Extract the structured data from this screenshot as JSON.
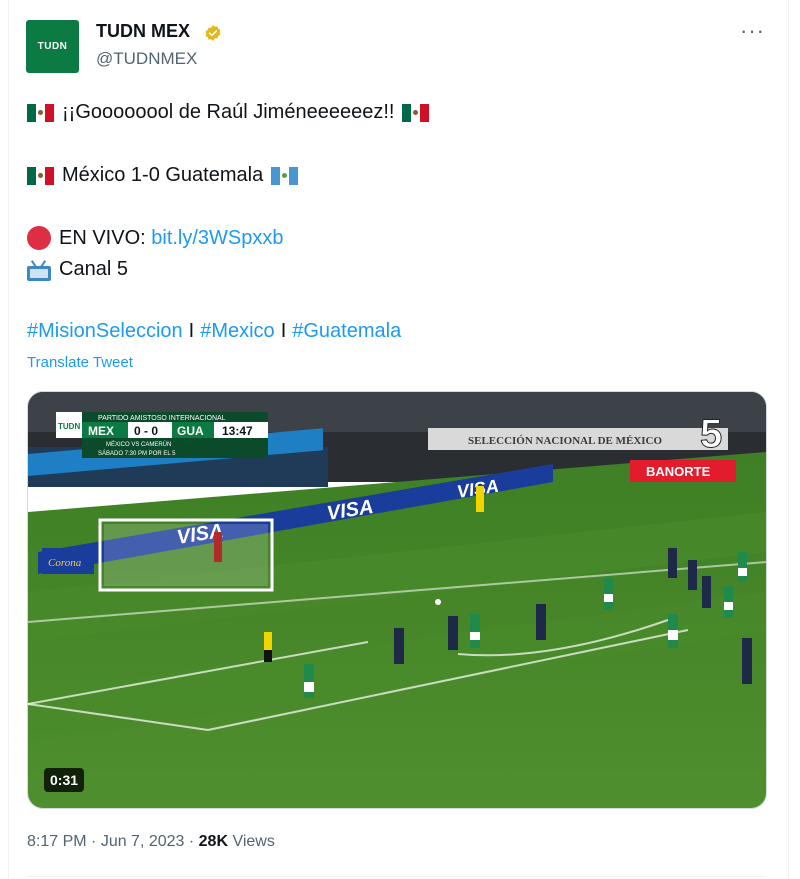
{
  "account": {
    "avatar_text": "TUDN",
    "name": "TUDN MEX",
    "handle": "@TUDNMEX",
    "verified_icon": "gold-verified-badge-icon",
    "more_icon": "more-dots-icon",
    "more_label": "···"
  },
  "tweet": {
    "line1_text": "¡¡Goooooool de Raúl Jiméneeeeeez!!",
    "line2_text": "México 1-0 Guatemala",
    "live_label": "EN VIVO: ",
    "live_link": "bit.ly/3WSpxxb",
    "channel_text": "Canal 5",
    "hashtags": [
      "#MisionSeleccion",
      "#Mexico",
      "#Guatemala"
    ],
    "hashtag_separator": "I",
    "translate_label": "Translate Tweet"
  },
  "video": {
    "duration": "0:31",
    "scoreboard": {
      "caption_top": "PARTIDO AMISTOSO INTERNACIONAL",
      "home": "MEX",
      "score": "0 - 0",
      "away": "GUA",
      "clock": "13:47",
      "caption_bottom1": "MÉXICO VS CAMERÚN",
      "caption_bottom2": "SÁBADO 7:30 PM POR EL 5",
      "logo_text": "TUDN"
    },
    "channel_logo": "5",
    "banner_text": "SELECCIÓN NACIONAL DE MÉXICO",
    "sponsor_banorte": "BANORTE",
    "sponsor_visa": "VISA",
    "sponsor_corona": "Corona"
  },
  "meta": {
    "time": "8:17 PM",
    "dot": " · ",
    "date": "Jun 7, 2023",
    "dot2": " · ",
    "views_count": "28K",
    "views_label": " Views"
  },
  "colors": {
    "brand_green": "#0b7a43",
    "link_blue": "#1d9bf0",
    "muted": "#536471",
    "verified_gold": "#e2b719",
    "pitch": "#4f8f2e"
  }
}
